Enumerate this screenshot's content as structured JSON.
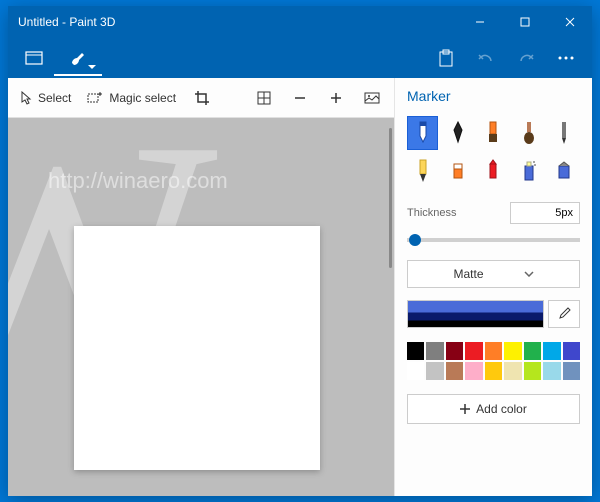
{
  "window": {
    "title": "Untitled - Paint 3D"
  },
  "toolbar": {
    "select": "Select",
    "magic_select": "Magic select"
  },
  "panel": {
    "title": "Marker",
    "thickness_label": "Thickness",
    "thickness_value": "5px",
    "material": "Matte",
    "add_color": "Add color"
  },
  "brushes": [
    {
      "name": "marker",
      "selected": true
    },
    {
      "name": "calligraphy-pen",
      "selected": false
    },
    {
      "name": "oil-brush",
      "selected": false
    },
    {
      "name": "watercolor",
      "selected": false
    },
    {
      "name": "pixel-pen",
      "selected": false
    },
    {
      "name": "pencil",
      "selected": false
    },
    {
      "name": "eraser",
      "selected": false
    },
    {
      "name": "crayon",
      "selected": false
    },
    {
      "name": "spray-can",
      "selected": false
    },
    {
      "name": "fill",
      "selected": false
    }
  ],
  "palette": [
    "#000000",
    "#7f7f7f",
    "#870014",
    "#ec1c23",
    "#ff7e26",
    "#fef100",
    "#21b14c",
    "#00a8e8",
    "#3f47cc",
    "#ffffff",
    "#c3c3c3",
    "#b97a57",
    "#feaec9",
    "#ffc90d",
    "#efe4b0",
    "#b5e61d",
    "#99d9ea",
    "#7092be"
  ],
  "watermark": "http://winaero.com"
}
